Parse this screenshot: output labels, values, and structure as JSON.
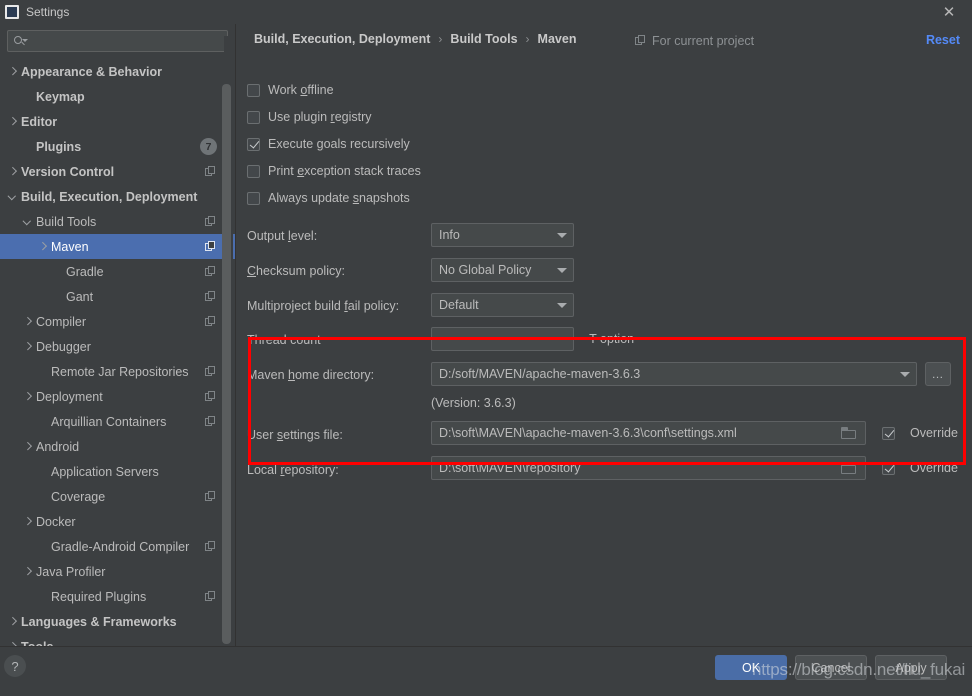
{
  "window": {
    "title": "Settings",
    "close_label": "✕",
    "app_icon": "idea-icon"
  },
  "sidebar": {
    "search": {
      "value": "",
      "placeholder": ""
    },
    "items": [
      {
        "label": "Appearance & Behavior",
        "indent": 0,
        "arrow": "right",
        "bold": true,
        "copy": false,
        "badge": null,
        "selected": false
      },
      {
        "label": "Keymap",
        "indent": 1,
        "arrow": "none",
        "bold": true,
        "copy": false,
        "badge": null,
        "selected": false
      },
      {
        "label": "Editor",
        "indent": 0,
        "arrow": "right",
        "bold": true,
        "copy": false,
        "badge": null,
        "selected": false
      },
      {
        "label": "Plugins",
        "indent": 1,
        "arrow": "none",
        "bold": true,
        "copy": false,
        "badge": "7",
        "selected": false
      },
      {
        "label": "Version Control",
        "indent": 0,
        "arrow": "right",
        "bold": true,
        "copy": true,
        "badge": null,
        "selected": false
      },
      {
        "label": "Build, Execution, Deployment",
        "indent": 0,
        "arrow": "down",
        "bold": true,
        "copy": false,
        "badge": null,
        "selected": false
      },
      {
        "label": "Build Tools",
        "indent": 1,
        "arrow": "down",
        "bold": false,
        "copy": true,
        "badge": null,
        "selected": false
      },
      {
        "label": "Maven",
        "indent": 2,
        "arrow": "right",
        "bold": false,
        "copy": true,
        "badge": null,
        "selected": true
      },
      {
        "label": "Gradle",
        "indent": 3,
        "arrow": "none",
        "bold": false,
        "copy": true,
        "badge": null,
        "selected": false
      },
      {
        "label": "Gant",
        "indent": 3,
        "arrow": "none",
        "bold": false,
        "copy": true,
        "badge": null,
        "selected": false
      },
      {
        "label": "Compiler",
        "indent": 1,
        "arrow": "right",
        "bold": false,
        "copy": true,
        "badge": null,
        "selected": false
      },
      {
        "label": "Debugger",
        "indent": 1,
        "arrow": "right",
        "bold": false,
        "copy": false,
        "badge": null,
        "selected": false
      },
      {
        "label": "Remote Jar Repositories",
        "indent": 2,
        "arrow": "none",
        "bold": false,
        "copy": true,
        "badge": null,
        "selected": false
      },
      {
        "label": "Deployment",
        "indent": 1,
        "arrow": "right",
        "bold": false,
        "copy": true,
        "badge": null,
        "selected": false
      },
      {
        "label": "Arquillian Containers",
        "indent": 2,
        "arrow": "none",
        "bold": false,
        "copy": true,
        "badge": null,
        "selected": false
      },
      {
        "label": "Android",
        "indent": 1,
        "arrow": "right",
        "bold": false,
        "copy": false,
        "badge": null,
        "selected": false
      },
      {
        "label": "Application Servers",
        "indent": 2,
        "arrow": "none",
        "bold": false,
        "copy": false,
        "badge": null,
        "selected": false
      },
      {
        "label": "Coverage",
        "indent": 2,
        "arrow": "none",
        "bold": false,
        "copy": true,
        "badge": null,
        "selected": false
      },
      {
        "label": "Docker",
        "indent": 1,
        "arrow": "right",
        "bold": false,
        "copy": false,
        "badge": null,
        "selected": false
      },
      {
        "label": "Gradle-Android Compiler",
        "indent": 2,
        "arrow": "none",
        "bold": false,
        "copy": true,
        "badge": null,
        "selected": false
      },
      {
        "label": "Java Profiler",
        "indent": 1,
        "arrow": "right",
        "bold": false,
        "copy": false,
        "badge": null,
        "selected": false
      },
      {
        "label": "Required Plugins",
        "indent": 2,
        "arrow": "none",
        "bold": false,
        "copy": true,
        "badge": null,
        "selected": false
      },
      {
        "label": "Languages & Frameworks",
        "indent": 0,
        "arrow": "right",
        "bold": true,
        "copy": false,
        "badge": null,
        "selected": false
      },
      {
        "label": "Tools",
        "indent": 0,
        "arrow": "right",
        "bold": true,
        "copy": false,
        "badge": null,
        "selected": false
      }
    ]
  },
  "header": {
    "breadcrumb": [
      "Build, Execution, Deployment",
      "Build Tools",
      "Maven"
    ],
    "separator": "›",
    "for_current_project": "For current project",
    "reset_label": "Reset"
  },
  "main": {
    "checkboxes": [
      {
        "label_pre": "Work ",
        "label_mn": "o",
        "label_post": "ffline",
        "checked": false
      },
      {
        "label_pre": "Use plugin ",
        "label_mn": "r",
        "label_post": "egistry",
        "checked": false
      },
      {
        "label_pre": "Execute ",
        "label_mn": "g",
        "label_post": "oals recursively",
        "checked": true
      },
      {
        "label_pre": "Print ",
        "label_mn": "e",
        "label_post": "xception stack traces",
        "checked": false
      },
      {
        "label_pre": "Always update ",
        "label_mn": "s",
        "label_post": "napshots",
        "checked": false
      }
    ],
    "combos": [
      {
        "label_pre": "Output ",
        "label_mn": "l",
        "label_post": "evel:",
        "value": "Info"
      },
      {
        "label_pre": "",
        "label_mn": "C",
        "label_post": "hecksum policy:",
        "value": "No Global Policy"
      },
      {
        "label_pre": "Multiproject build ",
        "label_mn": "f",
        "label_post": "ail policy:",
        "value": "Default"
      }
    ],
    "thread_count": {
      "label": "Thread count",
      "value": "",
      "hint": "-T option"
    },
    "maven_home": {
      "label_pre": "Maven ",
      "label_mn": "h",
      "label_post": "ome directory:",
      "value": "D:/soft/MAVEN/apache-maven-3.6.3",
      "browse_label": "…",
      "version_text": "(Version: 3.6.3)"
    },
    "user_settings": {
      "label_pre": "User ",
      "label_mn": "s",
      "label_post": "ettings file:",
      "value": "D:\\soft\\MAVEN\\apache-maven-3.6.3\\conf\\settings.xml",
      "override_label": "Override",
      "override_checked": true
    },
    "local_repository": {
      "label_pre": "Local ",
      "label_mn": "r",
      "label_post": "epository:",
      "value": "D:\\soft\\MAVEN\\repository",
      "override_label": "Override",
      "override_checked": true
    },
    "highlight_color": "#ff0000"
  },
  "footer": {
    "help_label": "?",
    "ok_label": "OK",
    "cancel_label": "Cancel",
    "apply_label": "Apply",
    "watermark": "https://blog.csdn.net/liu_fukai",
    "primary_color": "#4a6da7"
  }
}
